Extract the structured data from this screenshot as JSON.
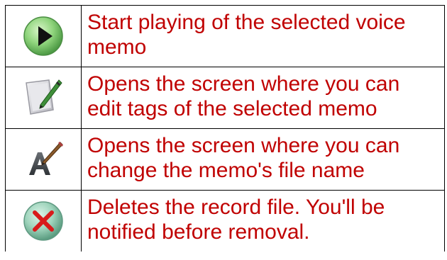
{
  "colors": {
    "text": "#c00000",
    "border": "#000000",
    "background": "#ffffff"
  },
  "rows": [
    {
      "icon": "play-icon",
      "description": "Start playing of the selected voice memo"
    },
    {
      "icon": "edit-tags-icon",
      "description": "Opens the screen where you can edit tags of the selected memo"
    },
    {
      "icon": "rename-icon",
      "description": "Opens the screen where you can change the memo's file name"
    },
    {
      "icon": "delete-icon",
      "description": "Deletes the record file. You'll be notified before removal."
    }
  ]
}
